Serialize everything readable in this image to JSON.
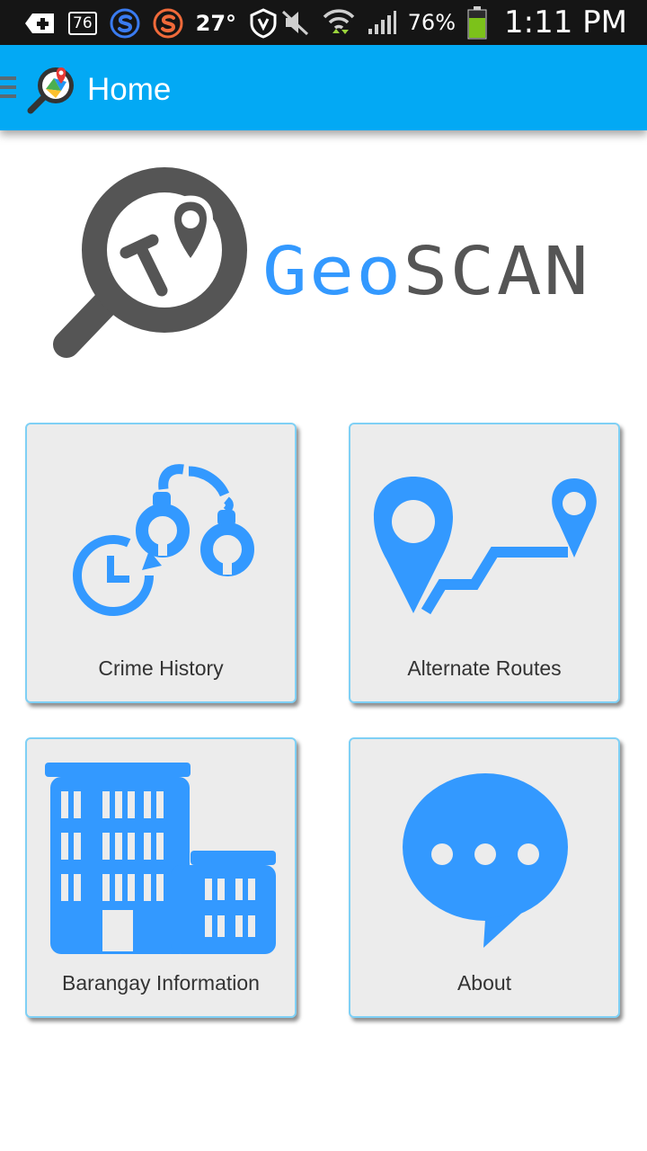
{
  "status_bar": {
    "notif_count": "76",
    "temperature": "27°",
    "battery_percent": "76%",
    "time": "1:11 PM",
    "icons": [
      "plus-icon",
      "notification-count-icon",
      "s-app-blue-icon",
      "s-app-orange-icon",
      "shield-icon",
      "mute-icon",
      "wifi-icon",
      "signal-icon",
      "battery-icon"
    ]
  },
  "app_bar": {
    "title": "Home",
    "icons": [
      "menu-icon",
      "app-logo-icon"
    ]
  },
  "brand": {
    "part1": "Geo",
    "part2": "SCAN",
    "icon": "magnifier-map-pin-icon"
  },
  "tiles": [
    {
      "label": "Crime History",
      "icon": "handcuffs-clock-icon"
    },
    {
      "label": "Alternate Routes",
      "icon": "route-pins-icon"
    },
    {
      "label": "Barangay Information",
      "icon": "building-icon"
    },
    {
      "label": "About",
      "icon": "chat-bubble-icon"
    }
  ],
  "colors": {
    "status_bar_bg": "#151515",
    "app_bar_bg": "#03a9f4",
    "accent_blue": "#3399ff",
    "dark_gray": "#555555",
    "tile_bg": "#ececec",
    "tile_border": "#7fd0f5"
  }
}
